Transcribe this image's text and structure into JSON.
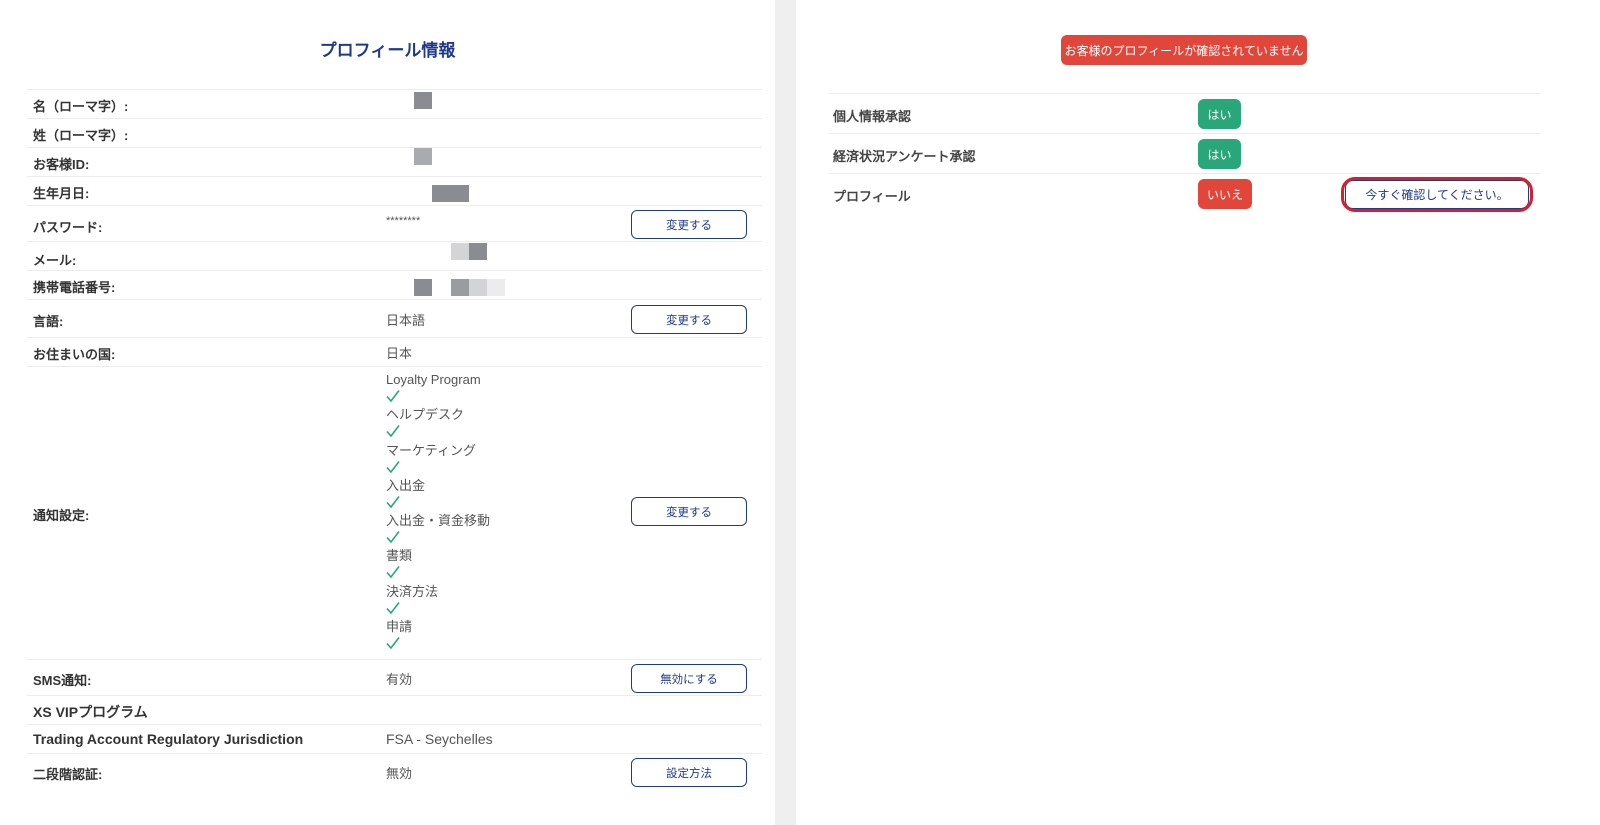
{
  "profile": {
    "title": "プロフィール情報",
    "rows": {
      "first_name": {
        "label": "名（ローマ字）:"
      },
      "last_name": {
        "label": "姓（ローマ字）:"
      },
      "customer_id": {
        "label": "お客様ID:"
      },
      "birthdate": {
        "label": "生年月日:"
      },
      "password": {
        "label": "パスワード:",
        "value": "********",
        "button": "変更する"
      },
      "email": {
        "label": "メール:"
      },
      "mobile": {
        "label": "携帯電話番号:"
      },
      "language": {
        "label": "言語:",
        "value": "日本語",
        "button": "変更する"
      },
      "country": {
        "label": "お住まいの国:",
        "value": "日本"
      },
      "notifications": {
        "label": "通知設定:",
        "button": "変更する",
        "items": [
          "Loyalty Program",
          "ヘルプデスク",
          "マーケティング",
          "入出金",
          "入出金・資金移動",
          "書類",
          "決済方法",
          "申請"
        ],
        "check_color": "#2aa77a"
      },
      "sms": {
        "label": "SMS通知:",
        "value": "有効",
        "button": "無効にする"
      },
      "vip": {
        "label": "XS VIPプログラム"
      },
      "jurisdiction": {
        "label": "Trading Account Regulatory Jurisdiction",
        "value": "FSA - Seychelles"
      },
      "two_factor": {
        "label": "二段階認証:",
        "value": "無効",
        "button": "設定方法"
      }
    }
  },
  "status": {
    "warning": "お客様のプロフィールが確認されていません",
    "rows": {
      "personal_info": {
        "label": "個人情報承認",
        "badge": "はい"
      },
      "economic_survey": {
        "label": "経済状況アンケート承認",
        "badge": "はい"
      },
      "profile": {
        "label": "プロフィール",
        "badge": "いいえ",
        "button": "今すぐ確認してください。"
      }
    }
  },
  "colors": {
    "accent_blue": "#1f3a8a",
    "success_green": "#2aa77a",
    "danger_red": "#e0463a",
    "highlight_red": "#d61f2c"
  }
}
